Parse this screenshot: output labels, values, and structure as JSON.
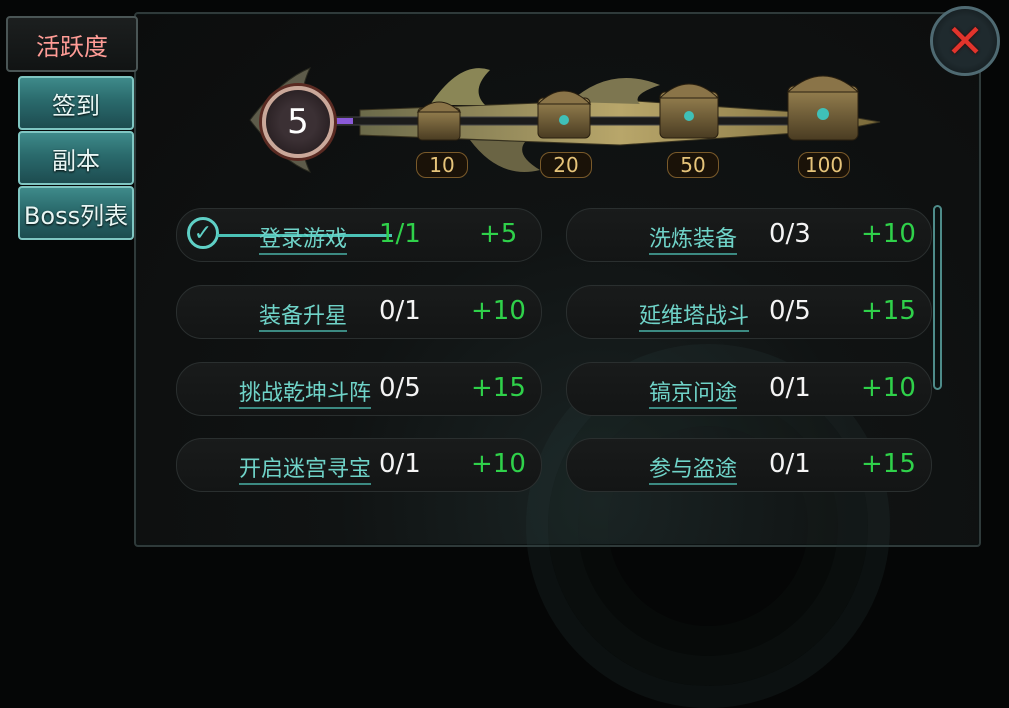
{
  "tabs": {
    "active": "活跃度",
    "items": [
      "签到",
      "副本",
      "Boss列表"
    ]
  },
  "activity": {
    "level": "5",
    "chests": [
      "10",
      "20",
      "50",
      "100"
    ]
  },
  "tasks": [
    {
      "name": "登录游戏",
      "progress": "1/1",
      "points": "+5",
      "done": true
    },
    {
      "name": "洗炼装备",
      "progress": "0/3",
      "points": "+10"
    },
    {
      "name": "装备升星",
      "progress": "0/1",
      "points": "+10"
    },
    {
      "name": "延维塔战斗",
      "progress": "0/5",
      "points": "+15"
    },
    {
      "name": "挑战乾坤斗阵",
      "progress": "0/5",
      "points": "+15"
    },
    {
      "name": "镐京问途",
      "progress": "0/1",
      "points": "+10"
    },
    {
      "name": "开启迷宫寻宝",
      "progress": "0/1",
      "points": "+10"
    },
    {
      "name": "参与盗途",
      "progress": "0/1",
      "points": "+15"
    }
  ],
  "icons": {
    "close": "close-x-icon",
    "check": "checkmark-icon",
    "chest": "treasure-chest-icon"
  },
  "colors": {
    "accent": "#2fd14a",
    "link": "#6fd3c8",
    "close": "#e2342c"
  }
}
